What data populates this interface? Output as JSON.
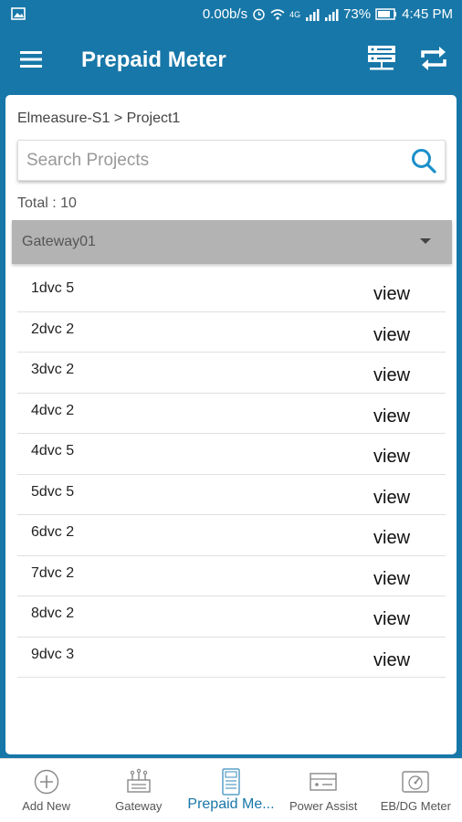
{
  "status_bar": {
    "net_speed": "0.00b/s",
    "network_label": "4G",
    "battery": "73%",
    "time": "4:45 PM"
  },
  "app_bar": {
    "title": "Prepaid Meter"
  },
  "breadcrumb": "Elmeasure-S1 > Project1",
  "search": {
    "placeholder": "Search Projects",
    "value": ""
  },
  "total_label": "Total : 10",
  "gateway_select": {
    "selected": "Gateway01"
  },
  "devices": [
    {
      "name": "1dvc 5",
      "action": "view"
    },
    {
      "name": "2dvc 2",
      "action": "view"
    },
    {
      "name": "3dvc 2",
      "action": "view"
    },
    {
      "name": "4dvc 2",
      "action": "view"
    },
    {
      "name": "4dvc 5",
      "action": "view"
    },
    {
      "name": "5dvc 5",
      "action": "view"
    },
    {
      "name": "6dvc 2",
      "action": "view"
    },
    {
      "name": "7dvc 2",
      "action": "view"
    },
    {
      "name": "8dvc 2",
      "action": "view"
    },
    {
      "name": "9dvc 3",
      "action": "view"
    }
  ],
  "bottom_nav": [
    {
      "label": "Add New",
      "icon": "add-circle-icon"
    },
    {
      "label": "Gateway",
      "icon": "gateway-icon"
    },
    {
      "label": "Prepaid Me...",
      "icon": "prepaid-meter-icon",
      "active": true
    },
    {
      "label": "Power Assist",
      "icon": "power-assist-icon"
    },
    {
      "label": "EB/DG Meter",
      "icon": "eb-dg-meter-icon"
    }
  ],
  "colors": {
    "primary": "#1777a8",
    "select_bg": "#b3b3b3",
    "active_tab": "#1777a8"
  }
}
